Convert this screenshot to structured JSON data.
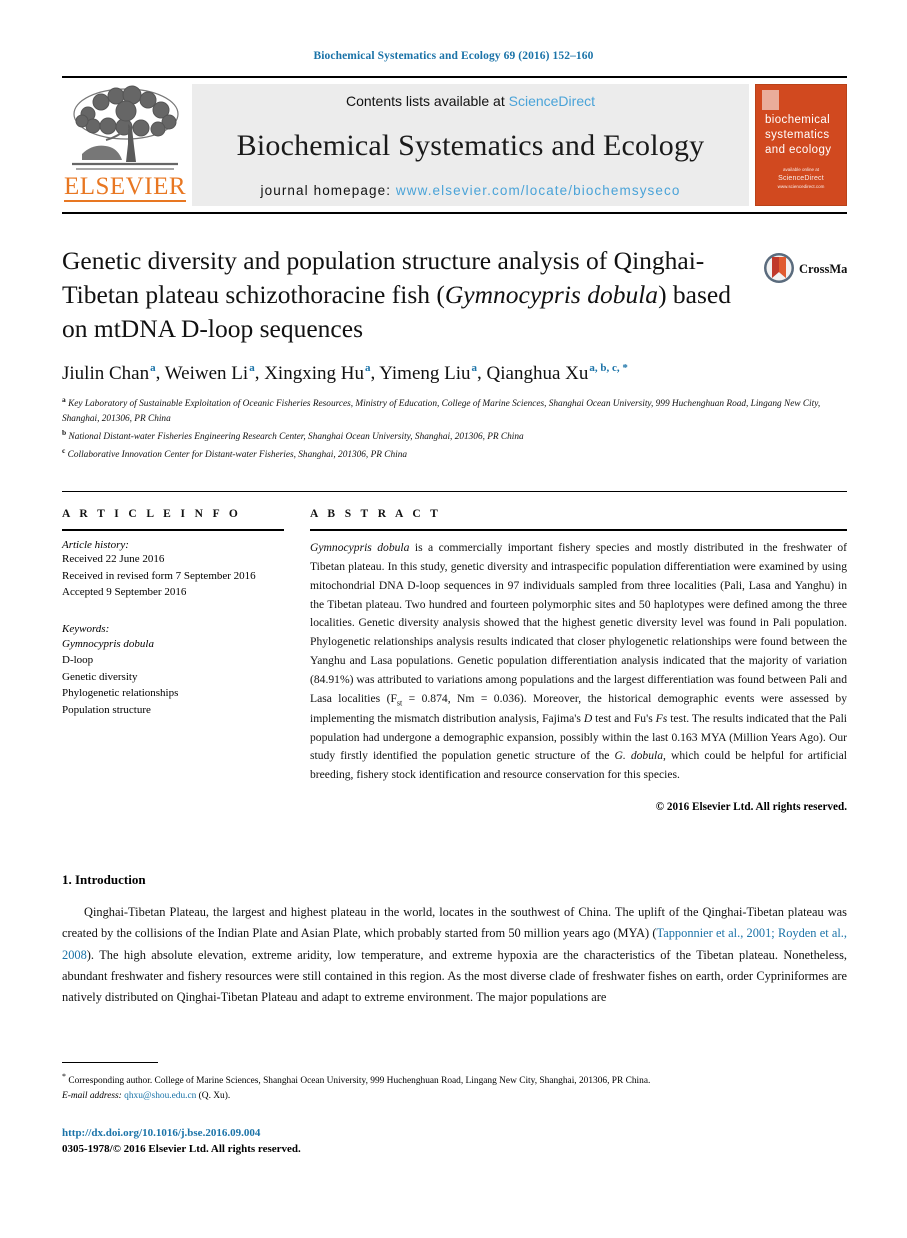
{
  "running_head": "Biochemical Systematics and Ecology 69 (2016) 152–160",
  "masthead": {
    "publisher_name": "ELSEVIER",
    "contents_prefix": "Contents lists available at ",
    "contents_link": "ScienceDirect",
    "journal_name": "Biochemical Systematics and Ecology",
    "homepage_prefix": "journal homepage: ",
    "homepage_url": "www.elsevier.com/locate/biochemsyseco",
    "cover": {
      "line1": "biochemical",
      "line2": "systematics",
      "line3": "and ecology",
      "footer_top": "available online at",
      "footer_brand": "ScienceDirect",
      "footer_url": "www.sciencedirect.com"
    }
  },
  "crossmark": {
    "label": "CrossMark"
  },
  "title": {
    "part1": "Genetic diversity and population structure analysis of Qinghai-Tibetan plateau schizothoracine fish (",
    "species_italic_1": "Gymnocypris dobula",
    "part2": ") based on mtDNA D-loop sequences"
  },
  "authors": [
    {
      "name": "Jiulin Chan",
      "sup": "a"
    },
    {
      "name": "Weiwen Li",
      "sup": "a"
    },
    {
      "name": "Xingxing Hu",
      "sup": "a"
    },
    {
      "name": "Yimeng Liu",
      "sup": "a"
    },
    {
      "name": "Qianghua Xu",
      "sup": "a, b, c, *"
    }
  ],
  "affiliations": [
    {
      "marker": "a",
      "text": "Key Laboratory of Sustainable Exploitation of Oceanic Fisheries Resources, Ministry of Education, College of Marine Sciences, Shanghai Ocean University, 999 Huchenghuan Road, Lingang New City, Shanghai, 201306, PR China"
    },
    {
      "marker": "b",
      "text": "National Distant-water Fisheries Engineering Research Center, Shanghai Ocean University, Shanghai, 201306, PR China"
    },
    {
      "marker": "c",
      "text": "Collaborative Innovation Center for Distant-water Fisheries, Shanghai, 201306, PR China"
    }
  ],
  "article_info": {
    "heading": "A R T I C L E   I N F O",
    "history_label": "Article history:",
    "history": [
      "Received 22 June 2016",
      "Received in revised form 7 September 2016",
      "Accepted 9 September 2016"
    ],
    "keywords_label": "Keywords:",
    "keywords": [
      "Gymnocypris dobula",
      "D-loop",
      "Genetic diversity",
      "Phylogenetic relationships",
      "Population structure"
    ],
    "keyword_italic_index": 0
  },
  "abstract": {
    "heading": "A B S T R A C T",
    "species_lead": "Gymnocypris dobula",
    "text_a": " is a commercially important fishery species and mostly distributed in the freshwater of Tibetan plateau. In this study, genetic diversity and intraspecific population differentiation were examined by using mitochondrial DNA D-loop sequences in 97 individuals sampled from three localities (Pali, Lasa and Yanghu) in the Tibetan plateau. Two hundred and fourteen polymorphic sites and 50 haplotypes were defined among the three localities. Genetic diversity analysis showed that the highest genetic diversity level was found in Pali population. Phylogenetic relationships analysis results indicated that closer phylogenetic relationships were found between the Yanghu and Lasa populations. Genetic population differentiation analysis indicated that the majority of variation (84.91%) was attributed to variations among populations and the largest differentiation was found between Pali and Lasa localities (F",
    "fst_sub": "st",
    "text_b": " = 0.874, Nm = 0.036). Moreover, the historical demographic events were assessed by implementing the mismatch distribution analysis, Fajima's ",
    "ital_d": "D",
    "text_c": " test and Fu's ",
    "ital_fs": "Fs",
    "text_d": " test. The results indicated that the Pali population had undergone a demographic expansion, possibly within the last 0.163 MYA (Million Years Ago). Our study firstly identified the population genetic structure of the ",
    "ital_gdobula": "G. dobula",
    "text_e": ", which could be helpful for artificial breeding, fishery stock identification and resource conservation for this species.",
    "copyright": "© 2016 Elsevier Ltd. All rights reserved."
  },
  "introduction": {
    "heading": "1. Introduction",
    "para_a": "Qinghai-Tibetan Plateau, the largest and highest plateau in the world, locates in the southwest of China. The uplift of the Qinghai-Tibetan plateau was created by the collisions of the Indian Plate and Asian Plate, which probably started from 50 million years ago (MYA) (",
    "citation": "Tapponnier et al., 2001; Royden et al., 2008",
    "para_b": "). The high absolute elevation, extreme aridity, low temperature, and extreme hypoxia are the characteristics of the Tibetan plateau. Nonetheless, abundant freshwater and fishery resources were still contained in this region. As the most diverse clade of freshwater fishes on earth, order Cypriniformes are natively distributed on Qinghai-Tibetan Plateau and adapt to extreme environment. The major populations are"
  },
  "footnote": {
    "marker": "*",
    "text_a": " Corresponding author. College of Marine Sciences, Shanghai Ocean University, 999 Huchenghuan Road, Lingang New City, Shanghai, 201306, PR China.",
    "email_label": "E-mail address:",
    "email": "qhxu@shou.edu.cn",
    "email_suffix": " (Q. Xu)."
  },
  "footer": {
    "doi": "http://dx.doi.org/10.1016/j.bse.2016.09.004",
    "issn_line": "0305-1978/© 2016 Elsevier Ltd. All rights reserved."
  },
  "colors": {
    "link_blue": "#1b73a8",
    "sciencedirect_blue": "#4aa3d8",
    "elsevier_orange": "#e87722",
    "cover_orange": "#d1491f"
  }
}
